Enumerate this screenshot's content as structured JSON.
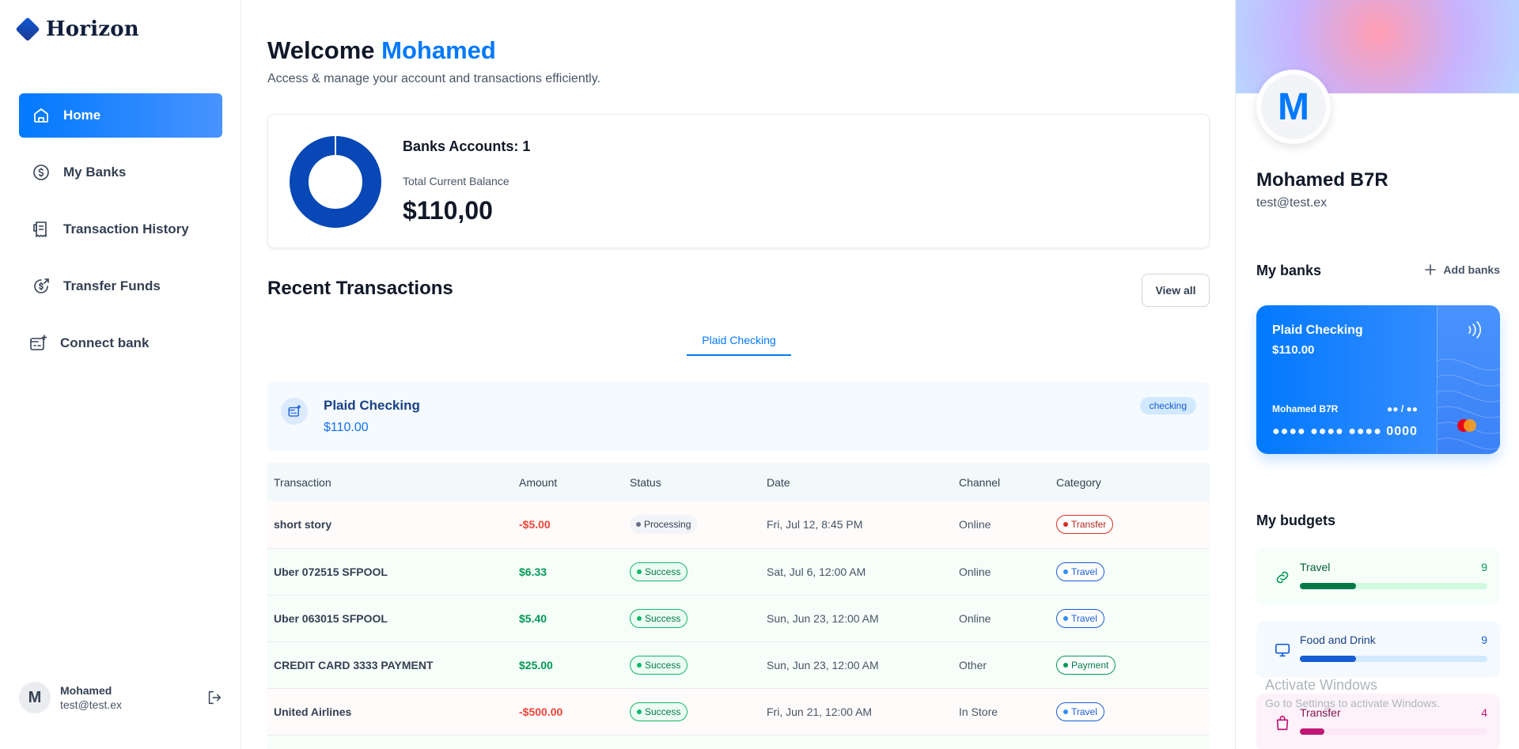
{
  "logo": {
    "text": "Horizon"
  },
  "sidebar": {
    "items": [
      {
        "label": "Home",
        "icon": "home-icon",
        "active": true
      },
      {
        "label": "My Banks",
        "icon": "dollar-circle-icon"
      },
      {
        "label": "Transaction History",
        "icon": "receipt-icon"
      },
      {
        "label": "Transfer Funds",
        "icon": "money-send-icon"
      },
      {
        "label": "Connect bank",
        "icon": "connect-bank-icon"
      }
    ],
    "user": {
      "initial": "M",
      "name": "Mohamed",
      "email": "test@test.ex"
    }
  },
  "header": {
    "welcome": "Welcome",
    "first_name": "Mohamed",
    "subtitle": "Access & manage your account and transactions efficiently."
  },
  "balance": {
    "banks_count": "Banks Accounts: 1",
    "total_label": "Total Current Balance",
    "total_value": "$110,00"
  },
  "recent": {
    "title": "Recent Transactions",
    "view_all": "View all",
    "tab": "Plaid Checking",
    "bank": {
      "name": "Plaid Checking",
      "balance": "$110.00",
      "type": "checking"
    },
    "columns": [
      "Transaction",
      "Amount",
      "Status",
      "Date",
      "Channel",
      "Category"
    ],
    "rows": [
      {
        "name": "short story",
        "amount": "-$5.00",
        "status": "Processing",
        "date": "Fri, Jul 12, 8:45 PM",
        "channel": "Online",
        "category": "Transfer"
      },
      {
        "name": "Uber 072515 SFPOOL",
        "amount": "$6.33",
        "status": "Success",
        "date": "Sat, Jul 6, 12:00 AM",
        "channel": "Online",
        "category": "Travel"
      },
      {
        "name": "Uber 063015 SFPOOL",
        "amount": "$5.40",
        "status": "Success",
        "date": "Sun, Jun 23, 12:00 AM",
        "channel": "Online",
        "category": "Travel"
      },
      {
        "name": "CREDIT CARD 3333 PAYMENT",
        "amount": "$25.00",
        "status": "Success",
        "date": "Sun, Jun 23, 12:00 AM",
        "channel": "Other",
        "category": "Payment"
      },
      {
        "name": "United Airlines",
        "amount": "-$500.00",
        "status": "Success",
        "date": "Fri, Jun 21, 12:00 AM",
        "channel": "In Store",
        "category": "Travel"
      }
    ]
  },
  "profile": {
    "initial": "M",
    "name": "Mohamed B7R",
    "email": "test@test.ex",
    "banks_title": "My banks",
    "add_banks": "Add banks"
  },
  "card": {
    "bank": "Plaid Checking",
    "balance": "$110.00",
    "holder": "Mohamed B7R",
    "expiry": "●● / ●●",
    "number": "●●●● ●●●● ●●●● 0000"
  },
  "budgets": {
    "title": "My budgets",
    "items": [
      {
        "label": "Travel",
        "count": "9",
        "progress": 0.3,
        "icon": "link-icon"
      },
      {
        "label": "Food and Drink",
        "count": "9",
        "progress": 0.3,
        "icon": "monitor-icon"
      },
      {
        "label": "Transfer",
        "count": "4",
        "progress": 0.13,
        "icon": "shopping-bag-icon"
      }
    ]
  },
  "watermark": {
    "line1": "Activate Windows",
    "line2": "Go to Settings to activate Windows."
  },
  "colors": {
    "accent": "#0179fe",
    "success": "#039855",
    "danger": "#f04438"
  }
}
